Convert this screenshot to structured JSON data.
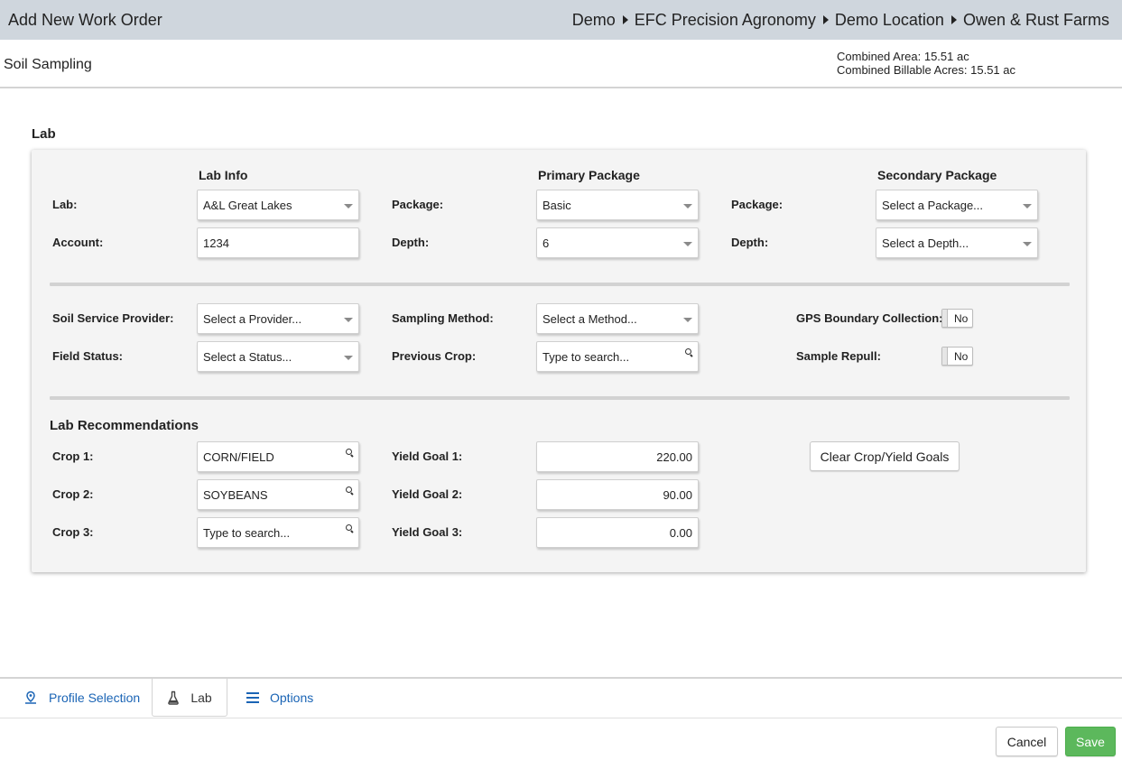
{
  "header": {
    "title": "Add New Work Order",
    "breadcrumbs": [
      "Demo",
      "EFC Precision Agronomy",
      "Demo Location",
      "Owen & Rust Farms"
    ]
  },
  "subheader": {
    "title": "Soil Sampling",
    "combined_area": "Combined Area: 15.51 ac",
    "combined_billable": "Combined Billable Acres: 15.51 ac"
  },
  "lab_section": {
    "title": "Lab",
    "col_lab_info": "Lab Info",
    "col_primary": "Primary Package",
    "col_secondary": "Secondary Package",
    "lab_label": "Lab:",
    "lab_value": "A&L Great Lakes",
    "account_label": "Account:",
    "account_value": "1234",
    "primary_package_label": "Package:",
    "primary_package_value": "Basic",
    "primary_depth_label": "Depth:",
    "primary_depth_value": "6",
    "secondary_package_label": "Package:",
    "secondary_package_placeholder": "Select a Package...",
    "secondary_depth_label": "Depth:",
    "secondary_depth_placeholder": "Select a Depth...",
    "soil_provider_label": "Soil Service Provider:",
    "soil_provider_placeholder": "Select a Provider...",
    "field_status_label": "Field Status:",
    "field_status_placeholder": "Select a Status...",
    "sampling_method_label": "Sampling Method:",
    "sampling_method_placeholder": "Select a Method...",
    "previous_crop_label": "Previous Crop:",
    "previous_crop_placeholder": "Type to search...",
    "gps_label": "GPS Boundary Collection:",
    "gps_value": "No",
    "repull_label": "Sample Repull:",
    "repull_value": "No"
  },
  "recommendations": {
    "title": "Lab Recommendations",
    "crops": [
      {
        "label": "Crop 1:",
        "value": "CORN/FIELD",
        "yield_label": "Yield Goal 1:",
        "yield_value": "220.00"
      },
      {
        "label": "Crop 2:",
        "value": "SOYBEANS",
        "yield_label": "Yield Goal 2:",
        "yield_value": "90.00"
      },
      {
        "label": "Crop 3:",
        "value": "Type to search...",
        "yield_label": "Yield Goal 3:",
        "yield_value": "0.00"
      }
    ],
    "clear_button": "Clear Crop/Yield Goals"
  },
  "tabs": [
    {
      "label": "Profile Selection",
      "icon": "map-pin-icon"
    },
    {
      "label": "Lab",
      "icon": "flask-icon"
    },
    {
      "label": "Options",
      "icon": "menu-lines-icon"
    }
  ],
  "footer": {
    "cancel": "Cancel",
    "save": "Save"
  },
  "colors": {
    "header_bg": "#cfd6dd",
    "link": "#1a64b5",
    "save": "#5cb85c"
  }
}
